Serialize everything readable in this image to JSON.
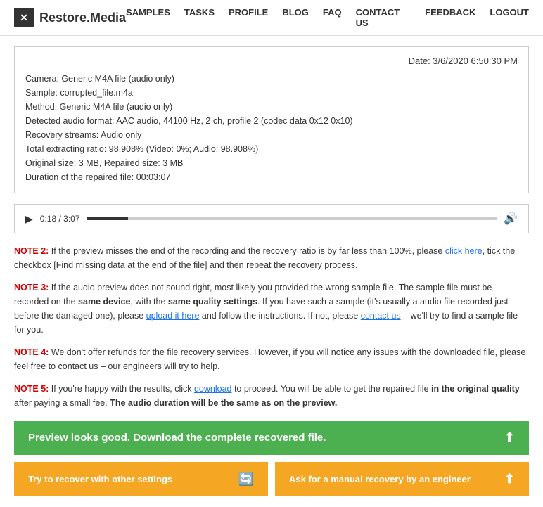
{
  "header": {
    "logo_text": "Restore.Media",
    "logo_icon": "✕",
    "nav_items": [
      "SAMPLES",
      "TASKS",
      "PROFILE",
      "BLOG",
      "FAQ",
      "CONTACT US",
      "FEEDBACK",
      "LOGOUT"
    ]
  },
  "info_box": {
    "date": "Date: 3/6/2020 6:50:30 PM",
    "lines": [
      "Camera: Generic M4A file (audio only)",
      "Sample: corrupted_file.m4a",
      "Method: Generic M4A file (audio only)",
      "Detected audio format: AAC audio, 44100 Hz, 2 ch, profile 2 (codec data 0x12 0x10)",
      "Recovery streams: Audio only",
      "Total extracting ratio: 98.908% (Video: 0%; Audio: 98.908%)",
      "Original size: 3 MB, Repaired size: 3 MB",
      "Duration of the repaired file: 00:03:07"
    ]
  },
  "audio_player": {
    "time": "0:18 / 3:07",
    "progress_percent": 10
  },
  "notes": [
    {
      "id": "note2",
      "label": "NOTE 2:",
      "text_before": " If the preview misses the end of the recording and the recovery ratio is by far less than 100%, please ",
      "link1_text": "click here",
      "text_after": ", tick the checkbox [Find missing data at the end of the file] and then repeat the recovery process.",
      "has_link": true
    },
    {
      "id": "note3",
      "label": "NOTE 3:",
      "text_before": " If the audio preview does not sound right, most likely you provided the wrong sample file. The sample file must be recorded on the ",
      "bold1": "same device",
      "text_mid1": ", with the ",
      "bold2": "same quality settings",
      "text_mid2": ". If you have such a sample (it's usually a audio file recorded just before the damaged one), please ",
      "link1_text": "upload it here",
      "text_after": " and follow the instructions. If not, please ",
      "link2_text": "contact us",
      "text_end": " – we'll try to find a sample file for you.",
      "has_link": true
    },
    {
      "id": "note4",
      "label": "NOTE 4:",
      "text": " We don't offer refunds for the file recovery services. However, if you will notice any issues with the downloaded file, please feel free to contact us – our engineers will try to help."
    },
    {
      "id": "note5",
      "label": "NOTE 5:",
      "text_before": " If you're happy with the results, click ",
      "link1_text": "download",
      "text_after": " to proceed. You will be able to get the repaired file ",
      "bold1": "in the original quality",
      "text_end": " after paying a small fee. ",
      "bold2": "The audio duration will be the same as on the preview."
    }
  ],
  "buttons": {
    "green_label": "Preview looks good. Download the complete recovered file.",
    "orange1_label": "Try to recover with other settings",
    "orange2_label": "Ask for a manual recovery by an engineer"
  }
}
